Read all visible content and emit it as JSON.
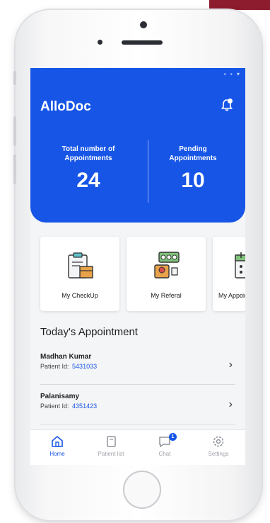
{
  "app": {
    "title": "AlloDoc"
  },
  "stats": {
    "total": {
      "label": "Total number of Appointments",
      "value": "24"
    },
    "pending": {
      "label": "Pending Appointments",
      "value": "10"
    }
  },
  "cards": [
    {
      "label": "My CheckUp",
      "icon": "clipboard-box-icon"
    },
    {
      "label": "My Referal",
      "icon": "referral-icon"
    },
    {
      "label": "My Appoint",
      "icon": "calendar-icon"
    }
  ],
  "section": {
    "title": "Today's Appointment"
  },
  "appointments": [
    {
      "name": "Madhan Kumar",
      "id_label": "Patient Id:",
      "id": "5431033"
    },
    {
      "name": "Palanisamy",
      "id_label": "Patient Id:",
      "id": "4351423"
    }
  ],
  "nav": {
    "home": "Home",
    "patients": "Patient list",
    "chat": "Chat",
    "chat_badge": "1",
    "settings": "Settings"
  },
  "colors": {
    "primary": "#1655e6",
    "accent_corner": "#8c1c2e"
  }
}
